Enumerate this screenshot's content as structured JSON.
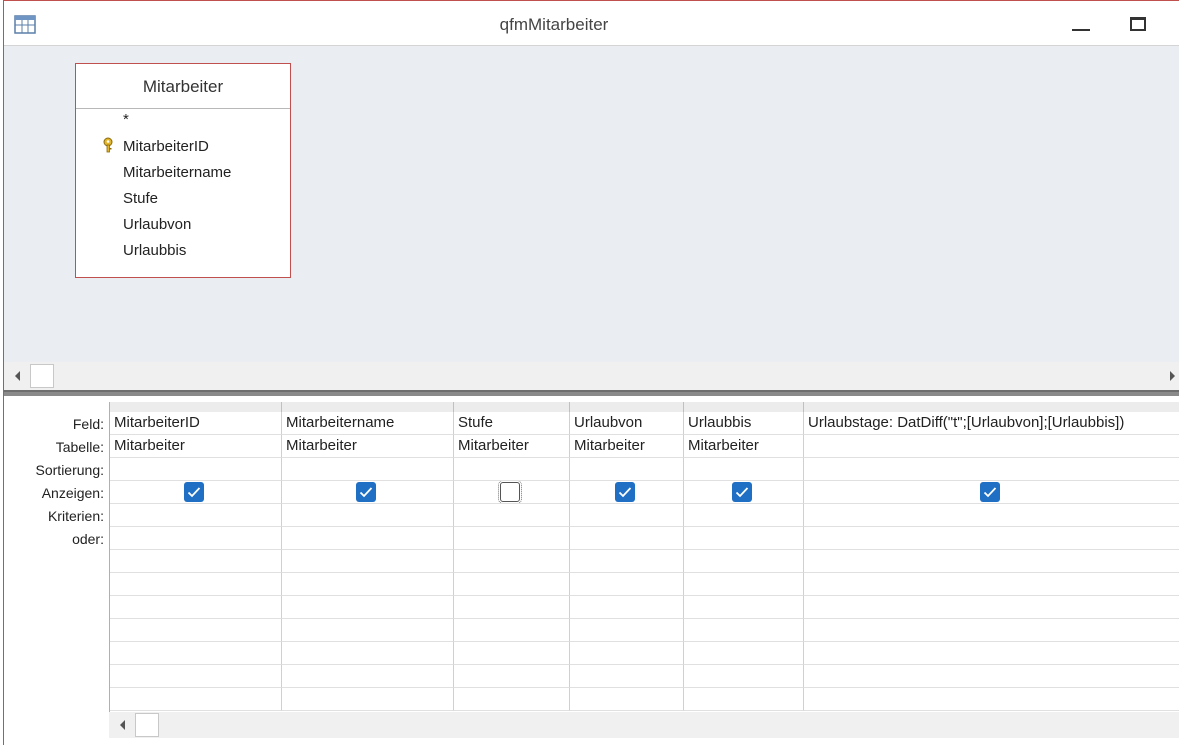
{
  "window": {
    "title": "qfmMitarbeiter"
  },
  "table": {
    "name": "Mitarbeiter",
    "fields": [
      "*",
      "MitarbeiterID",
      "Mitarbeitername",
      "Stufe",
      "Urlaubvon",
      "Urlaubbis"
    ],
    "primary_key": "MitarbeiterID"
  },
  "grid": {
    "row_labels": {
      "feld": "Feld:",
      "tabelle": "Tabelle:",
      "sortierung": "Sortierung:",
      "anzeigen": "Anzeigen:",
      "kriterien": "Kriterien:",
      "oder": "oder:"
    },
    "columns": [
      {
        "feld": "MitarbeiterID",
        "tabelle": "Mitarbeiter",
        "anzeigen": true
      },
      {
        "feld": "Mitarbeitername",
        "tabelle": "Mitarbeiter",
        "anzeigen": true
      },
      {
        "feld": "Stufe",
        "tabelle": "Mitarbeiter",
        "anzeigen": false
      },
      {
        "feld": "Urlaubvon",
        "tabelle": "Mitarbeiter",
        "anzeigen": true
      },
      {
        "feld": "Urlaubbis",
        "tabelle": "Mitarbeiter",
        "anzeigen": true
      },
      {
        "feld": "Urlaubstage: DatDiff(\"t\";[Urlaubvon];[Urlaubbis])",
        "tabelle": "",
        "anzeigen": true
      }
    ]
  },
  "colors": {
    "accent": "#1f6fc5",
    "border": "#c0504d",
    "design_bg": "#eaedf1"
  }
}
